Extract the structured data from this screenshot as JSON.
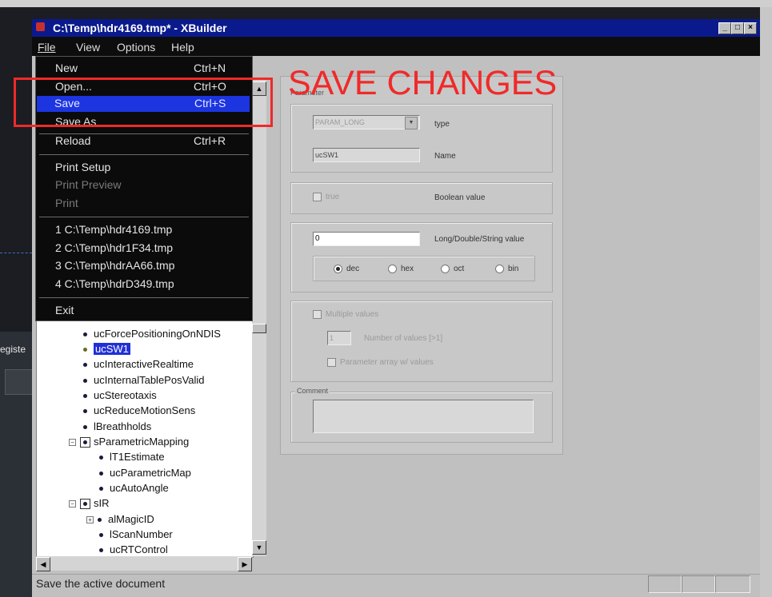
{
  "window": {
    "title": "C:\\Temp\\hdr4169.tmp* - XBuilder",
    "controls": [
      "_",
      "□",
      "×"
    ]
  },
  "menubar": [
    "File",
    "View",
    "Options",
    "Help"
  ],
  "file_menu": {
    "items": [
      {
        "label": "New",
        "accel": "Ctrl+N"
      },
      {
        "label": "Open...",
        "accel": "Ctrl+O"
      },
      {
        "label": "Save",
        "accel": "Ctrl+S"
      },
      {
        "label": "Save As",
        "accel": ""
      },
      {
        "label": "Reload",
        "accel": "Ctrl+R"
      },
      {
        "label": "Print Setup",
        "accel": ""
      },
      {
        "label": "Print Preview",
        "accel": ""
      },
      {
        "label": "Print",
        "accel": ""
      },
      {
        "label": "1 C:\\Temp\\hdr4169.tmp",
        "accel": ""
      },
      {
        "label": "2 C:\\Temp\\hdr1F34.tmp",
        "accel": ""
      },
      {
        "label": "3 C:\\Temp\\hdrAA66.tmp",
        "accel": ""
      },
      {
        "label": "4 C:\\Temp\\hdrD349.tmp",
        "accel": ""
      },
      {
        "label": "Exit",
        "accel": ""
      }
    ],
    "highlighted": "Save"
  },
  "annotation": {
    "text": "SAVE CHANGES",
    "color": "#ee2a2a"
  },
  "tree": {
    "nodes": [
      "ucForcePositioningOnNDIS",
      "ucSW1",
      "ucInteractiveRealtime",
      "ucInternalTablePosValid",
      "ucStereotaxis",
      "ucReduceMotionSens",
      "lBreathholds",
      "sParametricMapping",
      "lT1Estimate",
      "ucParametricMap",
      "ucAutoAngle",
      "sIR",
      "alMagicID",
      "lScanNumber",
      "ucRTControl"
    ],
    "selected": "ucSW1"
  },
  "properties": {
    "group1_caption": "Parameter",
    "type_value": "PARAM_LONG",
    "type_label": "type",
    "name_value": "ucSW1",
    "name_label": "Name",
    "bool_check_label": "true",
    "bool_label": "Boolean value",
    "value_field": "0",
    "value_label": "Long/Double/String value",
    "radix": [
      "dec",
      "hex",
      "oct",
      "bin"
    ],
    "radix_selected": "dec",
    "multiple_label": "Multiple values",
    "count_value": "1",
    "count_label": "Number of values [>1]",
    "param_array_label": "Parameter array w/ values",
    "comment_caption": "Comment",
    "comment_value": ""
  },
  "statusbar": {
    "text": "Save the active document"
  },
  "desktop": {
    "side_label": "egiste"
  }
}
